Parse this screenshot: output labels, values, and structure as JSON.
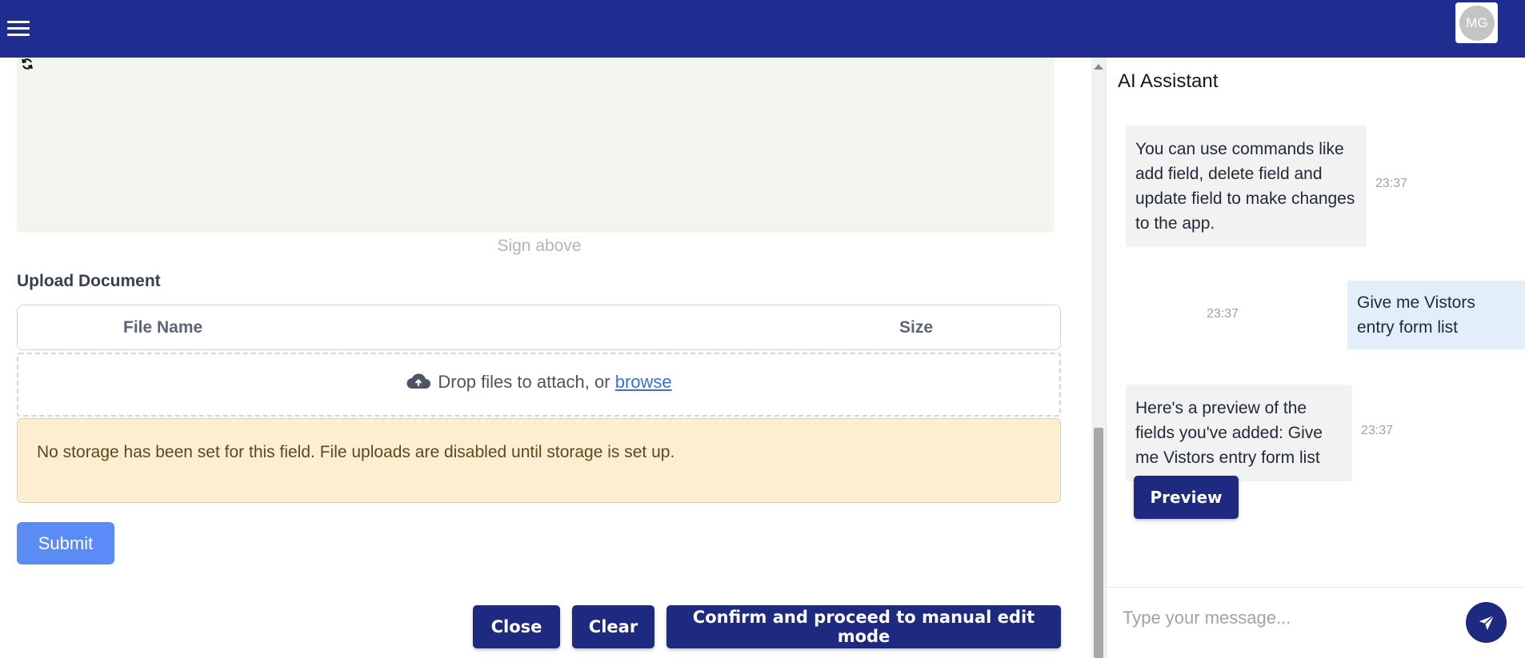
{
  "header": {
    "avatar_initials": "MG"
  },
  "form": {
    "sign_hint": "Sign above",
    "upload_label": "Upload Document",
    "table": {
      "columns": [
        "File Name",
        "Size"
      ]
    },
    "dropzone": {
      "text": "Drop files to attach, or",
      "browse_label": "browse"
    },
    "storage_warning": "No storage has been set for this field. File uploads are disabled until storage is set up.",
    "submit_label": "Submit"
  },
  "actions": {
    "close_label": "Close",
    "clear_label": "Clear",
    "confirm_label": "Confirm and proceed to manual edit mode"
  },
  "assistant": {
    "title": "AI Assistant",
    "messages": [
      {
        "role": "assistant",
        "text": "You can use commands like add field, delete field and update field to make changes to the app.",
        "time": "23:37"
      },
      {
        "role": "user",
        "text": "Give me Vistors entry form list",
        "time": "23:37"
      },
      {
        "role": "assistant",
        "text": "Here's a preview of the fields you've added: Give me Vistors entry form list",
        "time": "23:37"
      }
    ],
    "preview_label": "Preview",
    "input_placeholder": "Type your message..."
  },
  "colors": {
    "topbar": "#1e2d8f",
    "primary_button": "#1e2a7f",
    "submit_button": "#5b8cf5",
    "warning_bg": "#fdeed2",
    "user_bubble": "#e3eefb",
    "bot_bubble": "#f2f2f2"
  },
  "icons": [
    "menu-icon",
    "refresh-icon",
    "cloud-upload-icon",
    "send-icon"
  ]
}
